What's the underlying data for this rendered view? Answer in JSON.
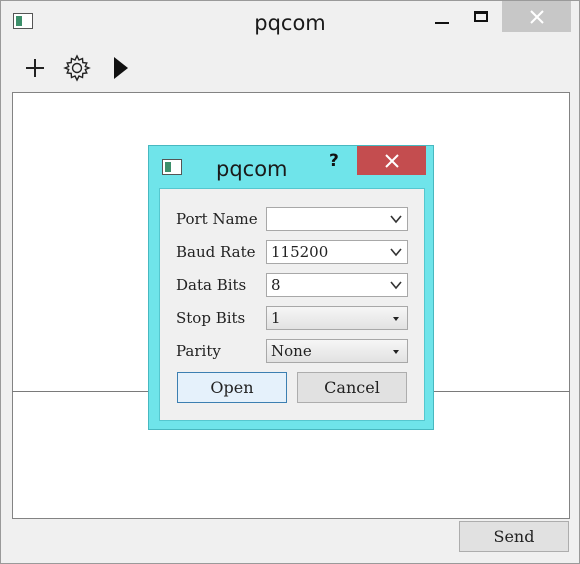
{
  "window": {
    "title": "pqcom"
  },
  "toolbar": {
    "items": [
      {
        "icon": "plus-icon"
      },
      {
        "icon": "gear-icon"
      },
      {
        "icon": "play-icon"
      }
    ]
  },
  "main": {
    "send_label": "Send"
  },
  "dialog": {
    "title": "pqcom",
    "help_label": "?",
    "fields": [
      {
        "label": "Port Name",
        "value": ""
      },
      {
        "label": "Baud Rate",
        "value": "115200"
      },
      {
        "label": "Data Bits",
        "value": "8"
      },
      {
        "label": "Stop Bits",
        "value": "1"
      },
      {
        "label": "Parity",
        "value": "None"
      }
    ],
    "open_label": "Open",
    "cancel_label": "Cancel"
  },
  "colors": {
    "dialog_frame": "#6fe4ea",
    "dialog_close": "#c44d4f",
    "window_close": "#c7c7c7"
  }
}
